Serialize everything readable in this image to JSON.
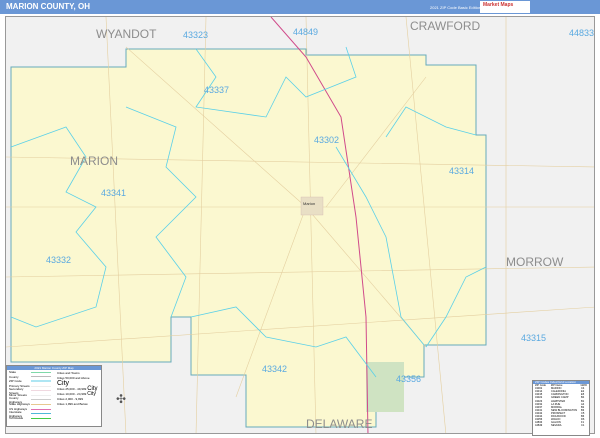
{
  "header": {
    "title": "MARION COUNTY, OH",
    "edition": "2021 ZIP Code Basic Edition",
    "logo": "Market Maps"
  },
  "counties": [
    "WYANDOT",
    "CRAWFORD",
    "MARION",
    "MORROW",
    "DELAWARE"
  ],
  "city": "Marion",
  "zips": [
    "43323",
    "44849",
    "44833",
    "43337",
    "43302",
    "43314",
    "43341",
    "43332",
    "43315",
    "43342",
    "43356"
  ],
  "legend": {
    "title": "2021 Marion County ZIP Map",
    "items": [
      "State",
      "County",
      "ZIP Code",
      "Primary Streets",
      "Secondary Streets",
      "Minor Streets",
      "County Highways",
      "State Highways",
      "US Highways",
      "Interstate Highways",
      "Toll Roads"
    ],
    "cities_title": "Cities and Towns",
    "cities": [
      "Cities 50,000 and Above",
      "Cities 25,000 - 49,999",
      "Cities 10,000 - 24,999",
      "Cities 2,000 - 9,999",
      "Cities 1,999 and Below"
    ],
    "city_sample": "City"
  },
  "index": {
    "title": "ZIP Codes Index/Grid Location",
    "cols": [
      "ZIP Code",
      "ZIP Name",
      "GRID"
    ],
    "rows": [
      [
        "43302",
        "MARION",
        "C4"
      ],
      [
        "43314",
        "CALEDONIA",
        "E2"
      ],
      [
        "43315",
        "CARDINGTON",
        "E5"
      ],
      [
        "43322",
        "GREEN CAMP",
        "B4"
      ],
      [
        "43323",
        "HARPSTER",
        "B1"
      ],
      [
        "43332",
        "LA RUE",
        "A4"
      ],
      [
        "43337",
        "MORRAL",
        "B2"
      ],
      [
        "43341",
        "NEW BLOOMINGTON",
        "B3"
      ],
      [
        "43342",
        "PROSPECT",
        "C5"
      ],
      [
        "43344",
        "RICHWOOD",
        "B6"
      ],
      [
        "43356",
        "WALDO",
        "D6"
      ],
      [
        "44833",
        "GALION",
        "F1"
      ],
      [
        "44849",
        "NEVADA",
        "C1"
      ]
    ]
  }
}
